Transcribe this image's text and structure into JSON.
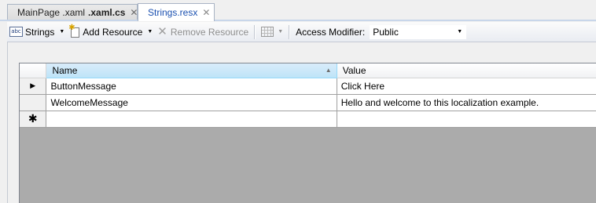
{
  "tabs": [
    {
      "label_prefix": "MainPage .xaml",
      "label_bold": ".xaml.cs",
      "close": "✕",
      "active": false
    },
    {
      "label": "Strings.resx",
      "close": "✕",
      "active": true
    }
  ],
  "toolbar": {
    "strings_label": "Strings",
    "strings_icon": "abc",
    "add_resource_label": "Add Resource",
    "remove_resource_label": "Remove Resource",
    "access_modifier_label": "Access Modifier:",
    "access_modifier_value": "Public"
  },
  "grid": {
    "columns": {
      "name": "Name",
      "value": "Value"
    },
    "rows": [
      {
        "indicator": "▶",
        "name": "ButtonMessage",
        "value": "Click Here"
      },
      {
        "indicator": "",
        "name": "WelcomeMessage",
        "value": "Hello and welcome to this localization example."
      },
      {
        "indicator": "✱",
        "name": "",
        "value": ""
      }
    ]
  },
  "colors": {
    "active_tab_text": "#1a50b0",
    "selected_header": "#bee4f8"
  }
}
